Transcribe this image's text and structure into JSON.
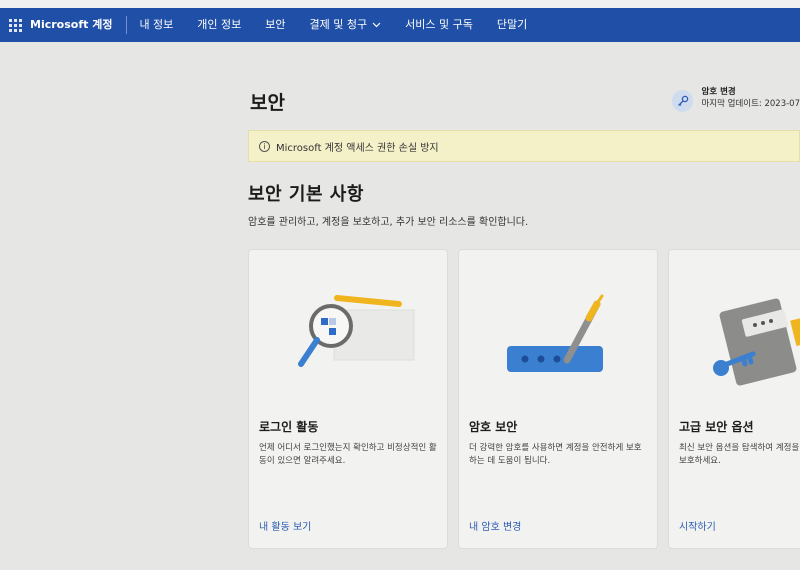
{
  "topbar": {
    "brand": "Microsoft 계정",
    "nav": [
      {
        "label": "내 정보"
      },
      {
        "label": "개인 정보"
      },
      {
        "label": "보안"
      },
      {
        "label": "결제 및 청구"
      },
      {
        "label": "서비스 및 구독"
      },
      {
        "label": "단말기"
      }
    ]
  },
  "page": {
    "title": "보안",
    "password": {
      "label": "암호 변경",
      "last_updated": "마지막 업데이트: 2023-07"
    },
    "banner": {
      "icon": "info-icon",
      "text": "Microsoft 계정 액세스 권한 손실 방지"
    },
    "section": {
      "title": "보안 기본 사항",
      "description": "암호를 관리하고, 계정을 보호하고, 추가 보안 리소스를 확인합니다."
    },
    "cards": [
      {
        "title": "로그인 활동",
        "description": "언제 어디서 로그인했는지 확인하고 비정상적인 활동이 있으면 알려주세요.",
        "link": "내 활동 보기",
        "icon": "magnifier-icon"
      },
      {
        "title": "암호 보안",
        "description": "더 강력한 암호를 사용하면 계정을 안전하게 보호하는 데 도움이 됩니다.",
        "link": "내 암호 변경",
        "icon": "password-pen-icon"
      },
      {
        "title": "고급 보안 옵션",
        "description": "최신 보안 옵션을 탐색하여 계정을 보호하세요.",
        "link": "시작하기",
        "icon": "key-book-icon"
      }
    ]
  },
  "colors": {
    "topbar": "#1f4fa6",
    "banner": "#f4f1c9",
    "link": "#2a5cb3",
    "accent_yellow": "#f0b51e",
    "accent_blue": "#3b7fd1"
  }
}
